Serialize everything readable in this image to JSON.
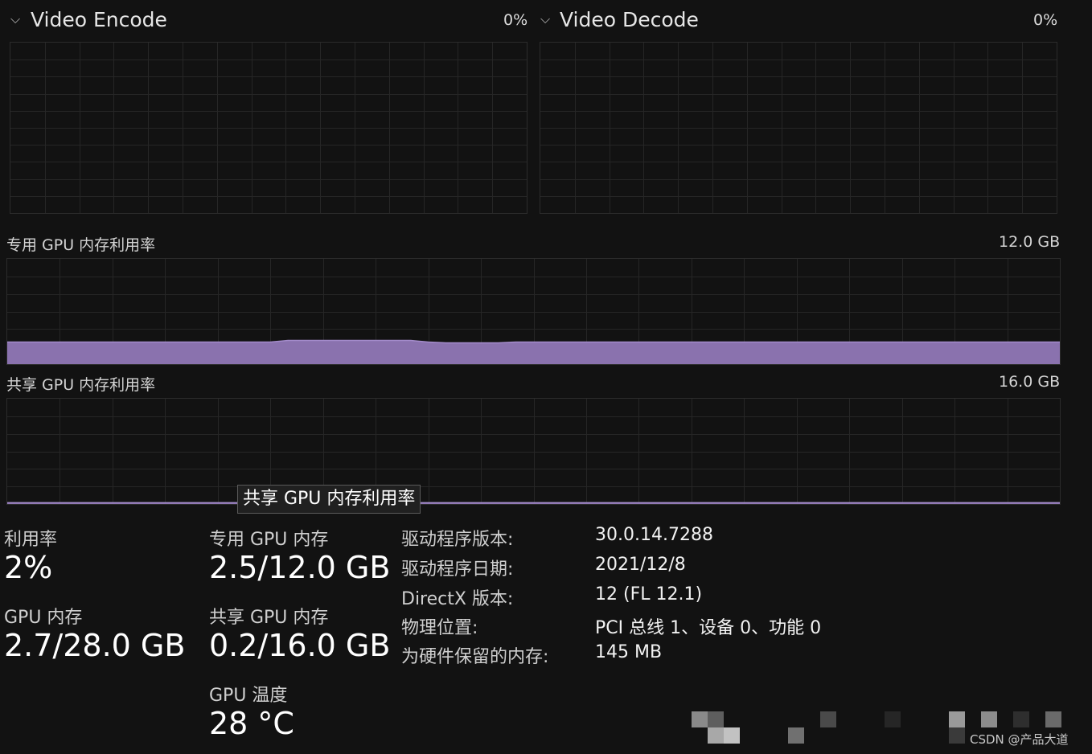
{
  "video_encode": {
    "title": "Video Encode",
    "value": "0%"
  },
  "video_decode": {
    "title": "Video Decode",
    "value": "0%"
  },
  "dedicated_chart": {
    "label": "专用 GPU 内存利用率",
    "max": "12.0 GB"
  },
  "shared_chart": {
    "label": "共享 GPU 内存利用率",
    "max": "16.0 GB"
  },
  "tooltip": "共享 GPU 内存利用率",
  "stats": {
    "utilization": {
      "label": "利用率",
      "value": "2%"
    },
    "dedicated_memory": {
      "label": "专用 GPU 内存",
      "value": "2.5/12.0 GB"
    },
    "gpu_memory": {
      "label": "GPU 内存",
      "value": "2.7/28.0 GB"
    },
    "shared_memory": {
      "label": "共享 GPU 内存",
      "value": "0.2/16.0 GB"
    },
    "temperature": {
      "label": "GPU 温度",
      "value": "28 °C"
    }
  },
  "properties": [
    {
      "label": "驱动程序版本:",
      "value": "30.0.14.7288"
    },
    {
      "label": "驱动程序日期:",
      "value": "2021/12/8"
    },
    {
      "label": "DirectX 版本:",
      "value": "12 (FL 12.1)"
    },
    {
      "label": "物理位置:",
      "value": "PCI 总线 1、设备 0、功能 0"
    },
    {
      "label": "为硬件保留的内存:",
      "value": "145 MB"
    }
  ],
  "watermark": "CSDN @产品大道",
  "colors": {
    "memory_fill": "#8a72ae",
    "memory_line": "#a48ccb",
    "grid": "#262626",
    "background": "#121212"
  },
  "dedicated_usage_fraction": 0.21,
  "shared_usage_fraction": 0.0125
}
